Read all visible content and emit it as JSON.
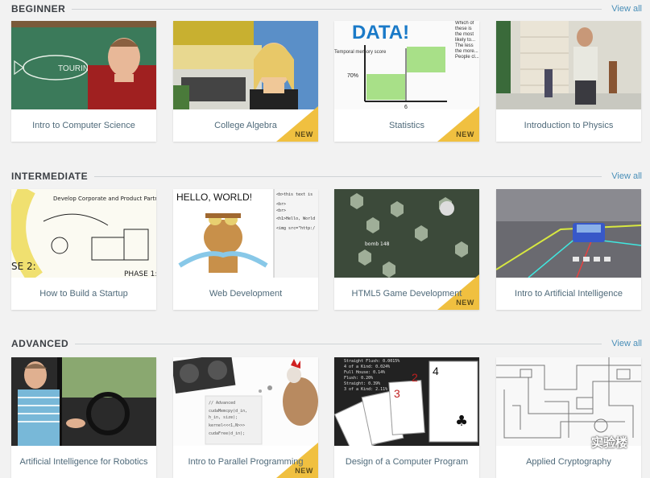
{
  "sections": [
    {
      "title": "BEGINNER",
      "view_all": "View all",
      "courses": [
        {
          "title": "Intro to Computer Science",
          "is_new": false
        },
        {
          "title": "College Algebra",
          "is_new": true
        },
        {
          "title": "Statistics",
          "is_new": true
        },
        {
          "title": "Introduction to Physics",
          "is_new": false
        }
      ]
    },
    {
      "title": "INTERMEDIATE",
      "view_all": "View all",
      "courses": [
        {
          "title": "How to Build a Startup",
          "is_new": false
        },
        {
          "title": "Web Development",
          "is_new": false
        },
        {
          "title": "HTML5 Game Development",
          "is_new": true
        },
        {
          "title": "Intro to Artificial Intelligence",
          "is_new": false
        }
      ]
    },
    {
      "title": "ADVANCED",
      "view_all": "View all",
      "courses": [
        {
          "title": "Artificial Intelligence for Robotics",
          "is_new": false
        },
        {
          "title": "Intro to Parallel Programming",
          "is_new": true
        },
        {
          "title": "Design of a Computer Program",
          "is_new": false
        },
        {
          "title": "Applied Cryptography",
          "is_new": false
        }
      ]
    }
  ],
  "badge_label": "NEW",
  "thumb_text": {
    "cs_sign": "TOURING",
    "stats_title": "DATA!",
    "stats_ylabel": "Temporal memory score",
    "stats_tick_y": "70%",
    "stats_tick_x": "6",
    "stats_note": "Which of these is the most likely to... The less the more... People cl...",
    "webdev_hello": "HELLO, WORLD!",
    "webdev_code": [
      "<b>this text is",
      "<br>",
      "<br>",
      "<h1>Hello, World",
      "<img src=\"http:/"
    ],
    "startup_note": "Develop Corporate and Product Partnership",
    "startup_phase": "PHASE 1:",
    "startup_se": "SE 2:",
    "game_score": "bomb 148",
    "cards_text": [
      "Straight Flush: 0.0015%",
      "4 of a Kind: 0.024%",
      "Full House: 0.14%",
      "Flush: 0.20%",
      "Straight: 0.39%",
      "3 of a Kind: 2.11%"
    ],
    "parallel_code": [
      "// Advanced",
      "cudaMemcpy(d_in,",
      "h_in, size);",
      "kernel<<<1,N>>>",
      "cudaFree(d_in);"
    ],
    "watermark": "实验楼"
  },
  "colors": {
    "background": "#f2f2f2",
    "caption": "#4f6a7a",
    "link": "#4a8fb8",
    "badge": "#f0c040"
  }
}
